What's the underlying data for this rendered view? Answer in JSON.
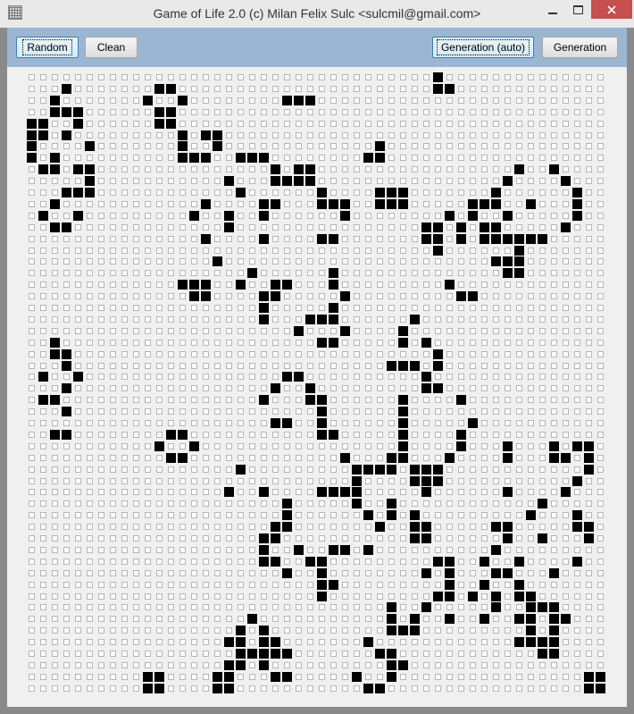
{
  "window": {
    "title": "Game of Life 2.0 (c) Milan Felix Sulc <sulcmil@gmail.com>",
    "app_icon": "grid-icon",
    "close_glyph": "✕",
    "close_color": "#c74f4f"
  },
  "toolbar": {
    "random_label": "Random",
    "clean_label": "Clean",
    "generation_auto_label": "Generation (auto)",
    "generation_label": "Generation",
    "background_color": "#9ab6d2"
  },
  "grid": {
    "columns": 50,
    "rows": 54,
    "alive_color": "#000000",
    "dead_color": "#ffffff",
    "alive_cells": [
      [
        0,
        35
      ],
      [
        1,
        3
      ],
      [
        1,
        11
      ],
      [
        1,
        12
      ],
      [
        1,
        35
      ],
      [
        1,
        36
      ],
      [
        2,
        2
      ],
      [
        2,
        10
      ],
      [
        2,
        13
      ],
      [
        2,
        22
      ],
      [
        2,
        23
      ],
      [
        2,
        24
      ],
      [
        3,
        2
      ],
      [
        3,
        3
      ],
      [
        3,
        4
      ],
      [
        3,
        11
      ],
      [
        3,
        12
      ],
      [
        4,
        0
      ],
      [
        4,
        1
      ],
      [
        4,
        4
      ],
      [
        4,
        11
      ],
      [
        4,
        12
      ],
      [
        5,
        0
      ],
      [
        5,
        1
      ],
      [
        5,
        3
      ],
      [
        5,
        13
      ],
      [
        5,
        15
      ],
      [
        5,
        16
      ],
      [
        6,
        0
      ],
      [
        6,
        5
      ],
      [
        6,
        13
      ],
      [
        6,
        16
      ],
      [
        6,
        30
      ],
      [
        7,
        0
      ],
      [
        7,
        2
      ],
      [
        7,
        13
      ],
      [
        7,
        14
      ],
      [
        7,
        15
      ],
      [
        7,
        18
      ],
      [
        7,
        19
      ],
      [
        7,
        20
      ],
      [
        7,
        29
      ],
      [
        7,
        30
      ],
      [
        8,
        1
      ],
      [
        8,
        2
      ],
      [
        8,
        4
      ],
      [
        8,
        5
      ],
      [
        8,
        21
      ],
      [
        8,
        23
      ],
      [
        8,
        24
      ],
      [
        8,
        42
      ],
      [
        8,
        45
      ],
      [
        9,
        5
      ],
      [
        9,
        17
      ],
      [
        9,
        21
      ],
      [
        9,
        22
      ],
      [
        9,
        23
      ],
      [
        9,
        24
      ],
      [
        9,
        41
      ],
      [
        9,
        46
      ],
      [
        10,
        3
      ],
      [
        10,
        4
      ],
      [
        10,
        5
      ],
      [
        10,
        18
      ],
      [
        10,
        25
      ],
      [
        10,
        30
      ],
      [
        10,
        31
      ],
      [
        10,
        32
      ],
      [
        10,
        40
      ],
      [
        10,
        47
      ],
      [
        11,
        2
      ],
      [
        11,
        15
      ],
      [
        11,
        20
      ],
      [
        11,
        21
      ],
      [
        11,
        25
      ],
      [
        11,
        26
      ],
      [
        11,
        27
      ],
      [
        11,
        30
      ],
      [
        11,
        31
      ],
      [
        11,
        32
      ],
      [
        11,
        38
      ],
      [
        11,
        39
      ],
      [
        11,
        40
      ],
      [
        11,
        43
      ],
      [
        11,
        47
      ],
      [
        12,
        1
      ],
      [
        12,
        4
      ],
      [
        12,
        14
      ],
      [
        12,
        17
      ],
      [
        12,
        20
      ],
      [
        12,
        27
      ],
      [
        12,
        36
      ],
      [
        12,
        38
      ],
      [
        12,
        41
      ],
      [
        12,
        47
      ],
      [
        13,
        2
      ],
      [
        13,
        3
      ],
      [
        13,
        17
      ],
      [
        13,
        34
      ],
      [
        13,
        35
      ],
      [
        13,
        37
      ],
      [
        13,
        39
      ],
      [
        13,
        40
      ],
      [
        13,
        46
      ],
      [
        14,
        15
      ],
      [
        14,
        20
      ],
      [
        14,
        25
      ],
      [
        14,
        26
      ],
      [
        14,
        34
      ],
      [
        14,
        35
      ],
      [
        14,
        37
      ],
      [
        14,
        39
      ],
      [
        14,
        40
      ],
      [
        14,
        41
      ],
      [
        14,
        42
      ],
      [
        14,
        43
      ],
      [
        14,
        44
      ],
      [
        15,
        35
      ],
      [
        15,
        42
      ],
      [
        16,
        16
      ],
      [
        16,
        40
      ],
      [
        16,
        41
      ],
      [
        16,
        42
      ],
      [
        17,
        19
      ],
      [
        17,
        26
      ],
      [
        17,
        41
      ],
      [
        17,
        42
      ],
      [
        18,
        13
      ],
      [
        18,
        14
      ],
      [
        18,
        15
      ],
      [
        18,
        18
      ],
      [
        18,
        21
      ],
      [
        18,
        22
      ],
      [
        18,
        26
      ],
      [
        18,
        36
      ],
      [
        19,
        14
      ],
      [
        19,
        15
      ],
      [
        19,
        20
      ],
      [
        19,
        21
      ],
      [
        19,
        27
      ],
      [
        19,
        37
      ],
      [
        19,
        38
      ],
      [
        20,
        20
      ],
      [
        20,
        26
      ],
      [
        21,
        20
      ],
      [
        21,
        24
      ],
      [
        21,
        25
      ],
      [
        21,
        26
      ],
      [
        21,
        33
      ],
      [
        22,
        23
      ],
      [
        22,
        27
      ],
      [
        22,
        32
      ],
      [
        23,
        2
      ],
      [
        23,
        25
      ],
      [
        23,
        26
      ],
      [
        23,
        32
      ],
      [
        23,
        34
      ],
      [
        24,
        2
      ],
      [
        24,
        3
      ],
      [
        24,
        35
      ],
      [
        25,
        3
      ],
      [
        25,
        31
      ],
      [
        25,
        32
      ],
      [
        25,
        33
      ],
      [
        25,
        35
      ],
      [
        26,
        1
      ],
      [
        26,
        4
      ],
      [
        26,
        22
      ],
      [
        26,
        23
      ],
      [
        26,
        34
      ],
      [
        27,
        3
      ],
      [
        27,
        21
      ],
      [
        27,
        24
      ],
      [
        27,
        34
      ],
      [
        27,
        35
      ],
      [
        28,
        1
      ],
      [
        28,
        2
      ],
      [
        28,
        20
      ],
      [
        28,
        24
      ],
      [
        28,
        25
      ],
      [
        28,
        32
      ],
      [
        28,
        37
      ],
      [
        29,
        3
      ],
      [
        29,
        25
      ],
      [
        29,
        32
      ],
      [
        30,
        21
      ],
      [
        30,
        22
      ],
      [
        30,
        25
      ],
      [
        30,
        32
      ],
      [
        30,
        38
      ],
      [
        31,
        2
      ],
      [
        31,
        3
      ],
      [
        31,
        12
      ],
      [
        31,
        13
      ],
      [
        31,
        25
      ],
      [
        31,
        26
      ],
      [
        31,
        32
      ],
      [
        31,
        37
      ],
      [
        32,
        11
      ],
      [
        32,
        14
      ],
      [
        32,
        32
      ],
      [
        32,
        37
      ],
      [
        32,
        41
      ],
      [
        32,
        45
      ],
      [
        32,
        47
      ],
      [
        32,
        48
      ],
      [
        33,
        12
      ],
      [
        33,
        13
      ],
      [
        33,
        27
      ],
      [
        33,
        31
      ],
      [
        33,
        32
      ],
      [
        33,
        36
      ],
      [
        33,
        41
      ],
      [
        33,
        45
      ],
      [
        33,
        46
      ],
      [
        33,
        48
      ],
      [
        34,
        18
      ],
      [
        34,
        28
      ],
      [
        34,
        29
      ],
      [
        34,
        30
      ],
      [
        34,
        31
      ],
      [
        34,
        33
      ],
      [
        34,
        34
      ],
      [
        34,
        35
      ],
      [
        34,
        48
      ],
      [
        35,
        28
      ],
      [
        35,
        33
      ],
      [
        35,
        34
      ],
      [
        35,
        35
      ],
      [
        35,
        47
      ],
      [
        36,
        17
      ],
      [
        36,
        20
      ],
      [
        36,
        25
      ],
      [
        36,
        26
      ],
      [
        36,
        27
      ],
      [
        36,
        28
      ],
      [
        36,
        34
      ],
      [
        36,
        41
      ],
      [
        36,
        46
      ],
      [
        37,
        22
      ],
      [
        37,
        28
      ],
      [
        37,
        31
      ],
      [
        37,
        44
      ],
      [
        38,
        22
      ],
      [
        38,
        29
      ],
      [
        38,
        31
      ],
      [
        38,
        33
      ],
      [
        38,
        43
      ],
      [
        38,
        47
      ],
      [
        39,
        21
      ],
      [
        39,
        22
      ],
      [
        39,
        30
      ],
      [
        39,
        33
      ],
      [
        39,
        34
      ],
      [
        39,
        40
      ],
      [
        39,
        41
      ],
      [
        39,
        47
      ],
      [
        39,
        48
      ],
      [
        40,
        20
      ],
      [
        40,
        21
      ],
      [
        40,
        33
      ],
      [
        40,
        34
      ],
      [
        40,
        41
      ],
      [
        40,
        44
      ],
      [
        40,
        48
      ],
      [
        41,
        20
      ],
      [
        41,
        23
      ],
      [
        41,
        26
      ],
      [
        41,
        27
      ],
      [
        41,
        29
      ],
      [
        41,
        40
      ],
      [
        42,
        20
      ],
      [
        42,
        21
      ],
      [
        42,
        24
      ],
      [
        42,
        25
      ],
      [
        42,
        35
      ],
      [
        42,
        36
      ],
      [
        42,
        39
      ],
      [
        42,
        42
      ],
      [
        42,
        47
      ],
      [
        43,
        22
      ],
      [
        43,
        25
      ],
      [
        43,
        34
      ],
      [
        43,
        36
      ],
      [
        43,
        40
      ],
      [
        43,
        41
      ],
      [
        43,
        45
      ],
      [
        44,
        25
      ],
      [
        44,
        26
      ],
      [
        44,
        36
      ],
      [
        44,
        39
      ],
      [
        44,
        42
      ],
      [
        45,
        25
      ],
      [
        45,
        35
      ],
      [
        45,
        36
      ],
      [
        45,
        38
      ],
      [
        45,
        40
      ],
      [
        45,
        42
      ],
      [
        45,
        43
      ],
      [
        46,
        31
      ],
      [
        46,
        34
      ],
      [
        46,
        40
      ],
      [
        46,
        43
      ],
      [
        46,
        44
      ],
      [
        46,
        45
      ],
      [
        47,
        19
      ],
      [
        47,
        31
      ],
      [
        47,
        33
      ],
      [
        47,
        36
      ],
      [
        47,
        39
      ],
      [
        47,
        42
      ],
      [
        47,
        43
      ],
      [
        47,
        45
      ],
      [
        47,
        46
      ],
      [
        48,
        18
      ],
      [
        48,
        20
      ],
      [
        48,
        31
      ],
      [
        48,
        32
      ],
      [
        48,
        33
      ],
      [
        48,
        43
      ],
      [
        48,
        45
      ],
      [
        49,
        17
      ],
      [
        49,
        18
      ],
      [
        49,
        20
      ],
      [
        49,
        21
      ],
      [
        49,
        29
      ],
      [
        49,
        42
      ],
      [
        49,
        43
      ],
      [
        49,
        44
      ],
      [
        49,
        45
      ],
      [
        50,
        18
      ],
      [
        50,
        19
      ],
      [
        50,
        20
      ],
      [
        50,
        21
      ],
      [
        50,
        22
      ],
      [
        50,
        30
      ],
      [
        50,
        31
      ],
      [
        50,
        44
      ],
      [
        50,
        45
      ],
      [
        51,
        17
      ],
      [
        51,
        18
      ],
      [
        51,
        20
      ],
      [
        51,
        31
      ],
      [
        51,
        32
      ],
      [
        52,
        10
      ],
      [
        52,
        11
      ],
      [
        52,
        16
      ],
      [
        52,
        17
      ],
      [
        52,
        21
      ],
      [
        52,
        22
      ],
      [
        52,
        28
      ],
      [
        52,
        31
      ],
      [
        52,
        48
      ],
      [
        52,
        49
      ],
      [
        53,
        10
      ],
      [
        53,
        11
      ],
      [
        53,
        16
      ],
      [
        53,
        17
      ],
      [
        53,
        29
      ],
      [
        53,
        30
      ],
      [
        53,
        48
      ],
      [
        53,
        49
      ]
    ]
  }
}
